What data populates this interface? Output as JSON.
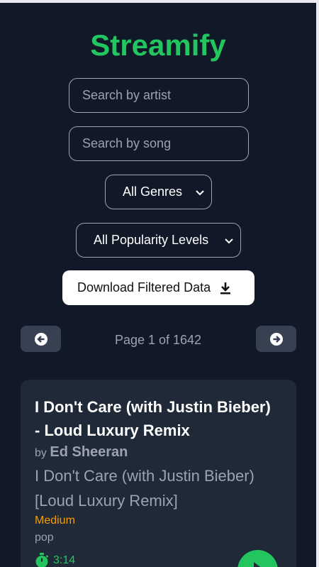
{
  "app": {
    "title": "Streamify"
  },
  "filters": {
    "artist_placeholder": "Search by artist",
    "song_placeholder": "Search by song",
    "genre_selected": "All Genres",
    "popularity_selected": "All Popularity Levels",
    "download_label": "Download Filtered Data"
  },
  "pagination": {
    "text": "Page 1 of 1642"
  },
  "card": {
    "title": "I Don't Care (with Justin Bieber) - Loud Luxury Remix",
    "by_label": "by",
    "artist": "Ed Sheeran",
    "album": "I Don't Care (with Justin Bieber) [Loud Luxury Remix]",
    "popularity": "Medium",
    "genre": "pop",
    "duration": "3:14"
  },
  "colors": {
    "accent": "#22c55e",
    "background": "#111827",
    "card": "#1f2937",
    "popularity_medium": "#f59e0b"
  },
  "icons": {
    "download": "download-icon",
    "prev": "arrow-left-circle-icon",
    "next": "arrow-right-circle-icon",
    "duration": "stopwatch-icon",
    "play": "play-icon"
  }
}
